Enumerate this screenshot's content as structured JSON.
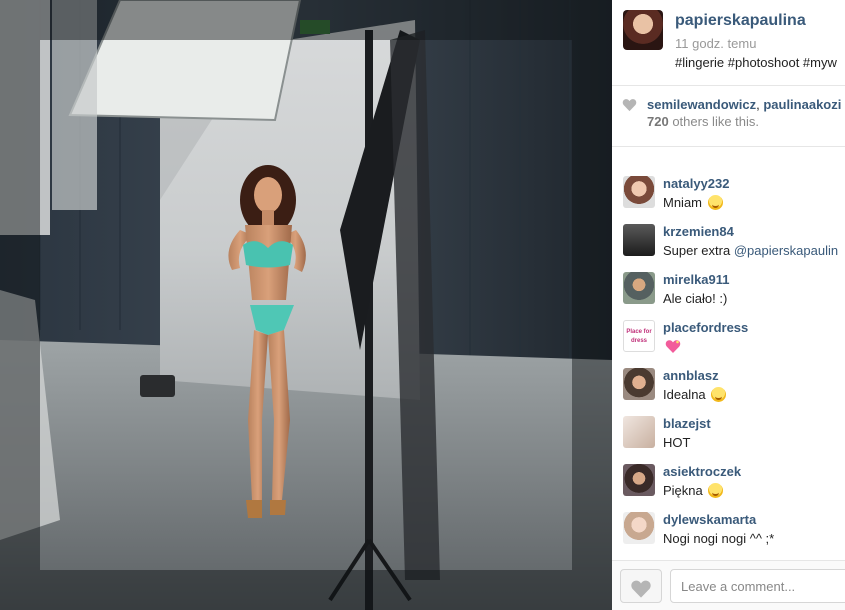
{
  "post": {
    "owner": "papierskapaulina",
    "time": "11 godz. temu",
    "caption": "#lingerie #photoshoot #myw"
  },
  "likes": {
    "user1": "semilewandowicz",
    "separator": ", ",
    "user2": "paulinaakozi",
    "count": "720",
    "count_suffix": " others like this."
  },
  "comments": [
    {
      "user": "natalyy232",
      "text": "Mniam ",
      "emoji": "smile"
    },
    {
      "user": "krzemien84",
      "text": "Super extra ",
      "mention": "@papierskapaulin"
    },
    {
      "user": "mirelka911",
      "text": "Ale ciało! :)"
    },
    {
      "user": "placefordress",
      "text": "",
      "emoji": "sparkling-heart",
      "avatar_text": "Place for dress"
    },
    {
      "user": "annblasz",
      "text": "Idealna ",
      "emoji": "smile"
    },
    {
      "user": "blazejst",
      "text": "HOT"
    },
    {
      "user": "asiektroczek",
      "text": "Piękna ",
      "emoji": "heart-eyes"
    },
    {
      "user": "dylewskamarta",
      "text": "Nogi nogi nogi ^^ ;*"
    }
  ],
  "footer": {
    "comment_placeholder": "Leave a comment..."
  },
  "colors": {
    "username": "#3a5a7a",
    "border": "#e6e6e6"
  }
}
